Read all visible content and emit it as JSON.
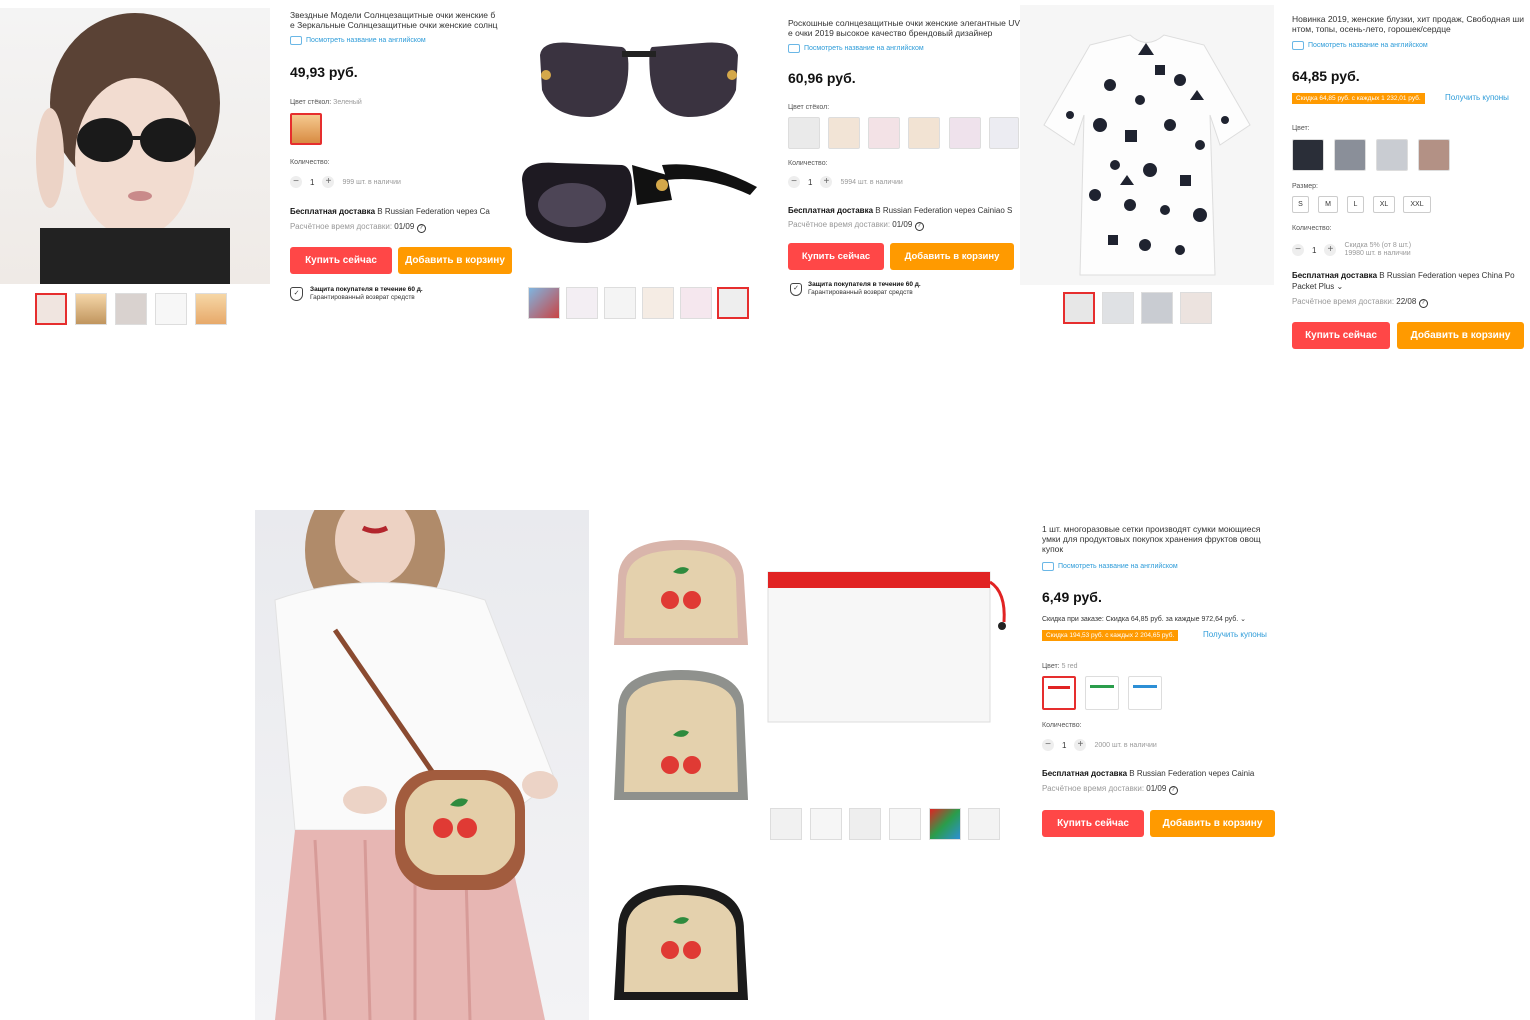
{
  "p1": {
    "title": "Звездные Модели Солнцезащитные очки женские б\nе Зеркальные Солнцезащитные очки женские солнц",
    "en_link": "Посмотреть название на английском",
    "price": "49,93 руб.",
    "color_label": "Цвет стёкол:",
    "color_value": "Зеленый",
    "qty_label": "Количество:",
    "qty": "1",
    "stock": "999 шт. в наличии",
    "ship_bold": "Бесплатная доставка",
    "ship_rest": " В Russian Federation через Ca",
    "eta_label": "Расчётное время доставки:",
    "eta_value": "01/09",
    "buy": "Купить сейчас",
    "cart": "Добавить в корзину",
    "protect_title": "Защита покупателя в течение 60 д.",
    "protect_sub": "Гарантированный возврат средств"
  },
  "p2": {
    "title": "Роскошные солнцезащитные очки женские элегантные UV\nе очки 2019 высокое качество брендовый дизайнер",
    "en_link": "Посмотреть название на английском",
    "price": "60,96 руб.",
    "color_label": "Цвет стёкол:",
    "qty_label": "Количество:",
    "qty": "1",
    "stock": "5994 шт. в наличии",
    "ship_bold": "Бесплатная доставка",
    "ship_rest": " В Russian Federation через Cainiao S",
    "eta_label": "Расчётное время доставки:",
    "eta_value": "01/09",
    "buy": "Купить сейчас",
    "cart": "Добавить в корзину",
    "protect_title": "Защита покупателя в течение 60 д.",
    "protect_sub": "Гарантированный возврат средств"
  },
  "p3": {
    "title": "Новинка 2019, женские блузки, хит продаж, Свободная ши\nнтом, топы, осень-лето, горошек/сердце",
    "en_link": "Посмотреть название на английском",
    "price": "64,85 руб.",
    "promo": "Скидка 64,85 руб. с каждых 1 232,01 руб.",
    "coupon": "Получить купоны",
    "color_label": "Цвет:",
    "size_label": "Размер:",
    "sizes": [
      "S",
      "M",
      "L",
      "XL",
      "XXL"
    ],
    "qty_label": "Количество:",
    "qty": "1",
    "discount_note": "Скидка 5% (от 8 шт.)",
    "stock": "19980 шт. в наличии",
    "ship_bold": "Бесплатная доставка",
    "ship_rest": " В Russian Federation через China Po",
    "ship_line2": "Packet Plus ⌄",
    "eta_label": "Расчётное время доставки:",
    "eta_value": "22/08",
    "buy": "Купить сейчас",
    "cart": "Добавить в корзину"
  },
  "p4": {
    "title": "1 шт. многоразовые сетки производят сумки моющиеся\nумки для продуктовых покупок хранения фруктов овощ\nкупок",
    "en_link": "Посмотреть название на английском",
    "price": "6,49 руб.",
    "order_discount": "Скидка при заказе: Скидка 64,85 руб. за каждые 972,64 руб. ⌄",
    "promo": "Скидка 194,53 руб. с каждых 2 204,65 руб.",
    "coupon": "Получить купоны",
    "color_label": "Цвет:",
    "color_value": "5 red",
    "qty_label": "Количество:",
    "qty": "1",
    "stock": "2000 шт. в наличии",
    "ship_bold": "Бесплатная доставка",
    "ship_rest": " В Russian Federation через Cainia",
    "eta_label": "Расчётное время доставки:",
    "eta_value": "01/09",
    "buy": "Купить сейчас",
    "cart": "Добавить в корзину"
  },
  "icons": {
    "minus": "−",
    "plus": "+",
    "help": "?",
    "check": "✓"
  },
  "colors": {
    "buy": "#ff4747",
    "cart": "#ff9a00",
    "link": "#2e9cd9",
    "selected": "#e62e2e"
  }
}
